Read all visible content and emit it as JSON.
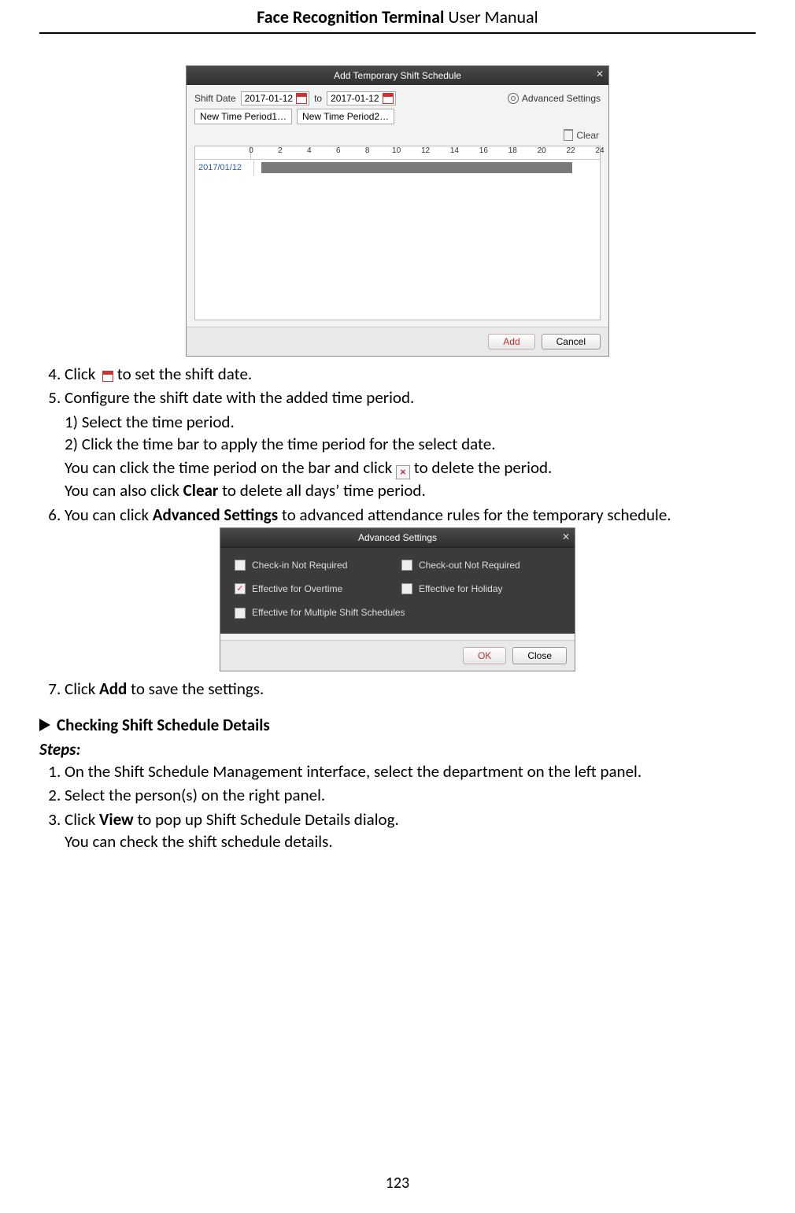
{
  "header": {
    "bold": "Face Recognition Terminal",
    "rest": "  User Manual"
  },
  "page_number": "123",
  "dlg1": {
    "title": "Add Temporary Shift Schedule",
    "shift_date_label": "Shift Date",
    "date_from": "2017-01-12",
    "to_label": "to",
    "date_to": "2017-01-12",
    "advanced": "Advanced Settings",
    "period_btns": [
      "New Time Period1…",
      "New Time Period2…"
    ],
    "clear": "Clear",
    "ticks": [
      "0",
      "2",
      "4",
      "6",
      "8",
      "10",
      "12",
      "14",
      "16",
      "18",
      "20",
      "22",
      "24"
    ],
    "row_date": "2017/01/12",
    "bar": {
      "left_pct": 2,
      "right_pct": 92
    },
    "add": "Add",
    "cancel": "Cancel"
  },
  "dlg2": {
    "title": "Advanced Settings",
    "opts": [
      {
        "label": "Check-in Not Required",
        "checked": false
      },
      {
        "label": "Check-out Not Required",
        "checked": false
      },
      {
        "label": "Effective for Overtime",
        "checked": true
      },
      {
        "label": "Effective for Holiday",
        "checked": false
      },
      {
        "label": "Effective for Multiple Shift Schedules",
        "checked": false
      }
    ],
    "ok": "OK",
    "close": "Close"
  },
  "txt": {
    "s4a": "Click ",
    "s4b": " to set the shift date.",
    "s5": "Configure the shift date with the added time period.",
    "s5_1": "1)   Select the time period.",
    "s5_2": "2)   Click the time bar to apply the time period for the select date.",
    "s5_na": "You can click the time period on the bar and click ",
    "s5_nb": " to delete the period.",
    "s5_n2a": "You can also click ",
    "s5_n2b": "Clear",
    "s5_n2c": " to delete all days’ time period.",
    "s6a": "You can click ",
    "s6b": "Advanced Settings",
    "s6c": " to advanced attendance rules for the temporary schedule.",
    "s7a": "Click ",
    "s7b": "Add",
    "s7c": " to save the settings.",
    "sect": "Checking Shift Schedule Details",
    "steps": "Steps:",
    "c1": "On the Shift Schedule Management interface, select the department on the left panel.",
    "c2": "Select the person(s) on the right panel.",
    "c3a": "Click ",
    "c3b": "View",
    "c3c": " to pop up Shift Schedule Details dialog.",
    "c3n": "You can check the shift schedule details."
  }
}
